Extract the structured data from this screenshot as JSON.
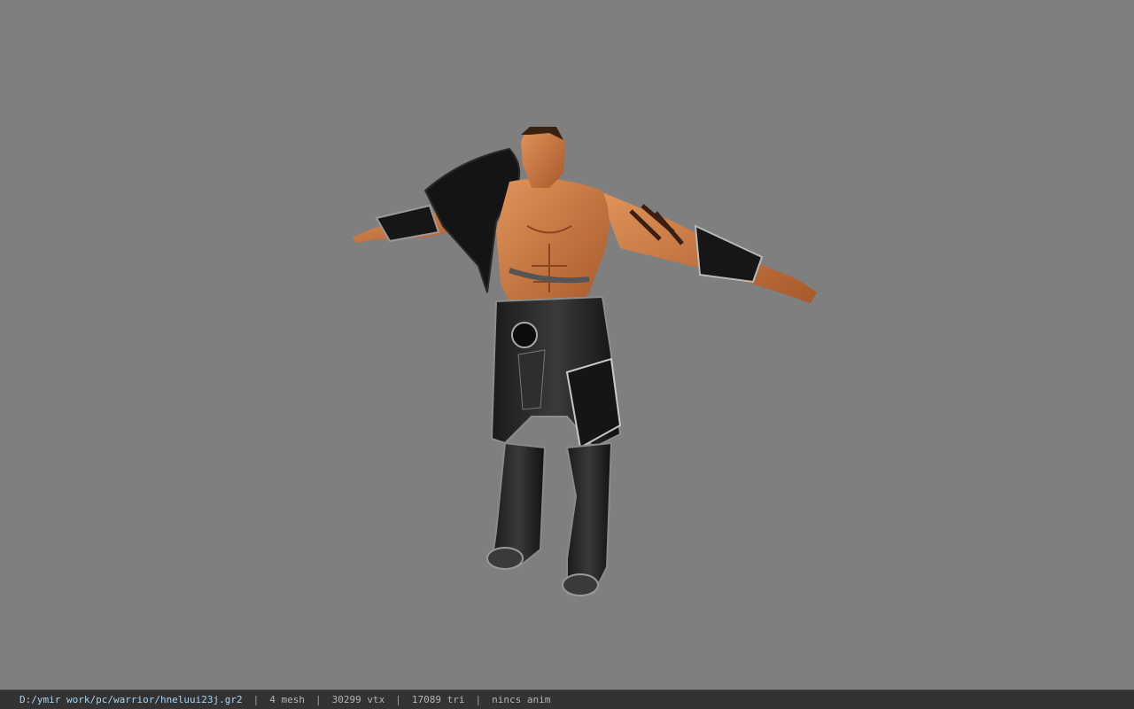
{
  "viewer": {
    "background_color": "#7f7f7f",
    "model_icon": "warrior-character-model"
  },
  "status_bar": {
    "file_path": "D:/ymir work/pc/warrior/hneluui23j.gr2",
    "separator": "|",
    "mesh": "4 mesh",
    "vertices": "30299 vtx",
    "triangles": "17089 tri",
    "animation": "nincs anim",
    "path_color": "#a8d4f0",
    "text_color": "#b4b4b4"
  }
}
